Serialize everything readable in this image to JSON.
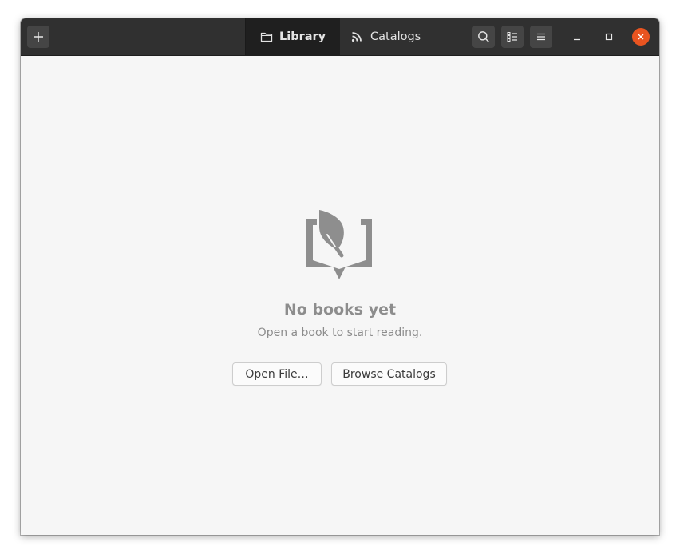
{
  "header": {
    "tabs": [
      {
        "label": "Library",
        "icon": "folder-icon",
        "active": true
      },
      {
        "label": "Catalogs",
        "icon": "rss-feed-icon",
        "active": false
      }
    ],
    "buttons": {
      "add_icon": "plus-icon",
      "search_icon": "search-icon",
      "view_icon": "list-view-icon",
      "menu_icon": "hamburger-menu-icon"
    },
    "window_controls": {
      "minimize_icon": "minimize-icon",
      "maximize_icon": "maximize-icon",
      "close_icon": "close-icon",
      "close_color": "#e95420"
    }
  },
  "empty_state": {
    "icon": "book-leaf-icon",
    "title": "No books yet",
    "description": "Open a book to start reading.",
    "open_button": "Open File…",
    "browse_button": "Browse Catalogs"
  },
  "colors": {
    "headerbar": "#303030",
    "active_tab": "#1f1f1f",
    "content_bg": "#f6f6f6",
    "accent_close": "#e95420"
  }
}
